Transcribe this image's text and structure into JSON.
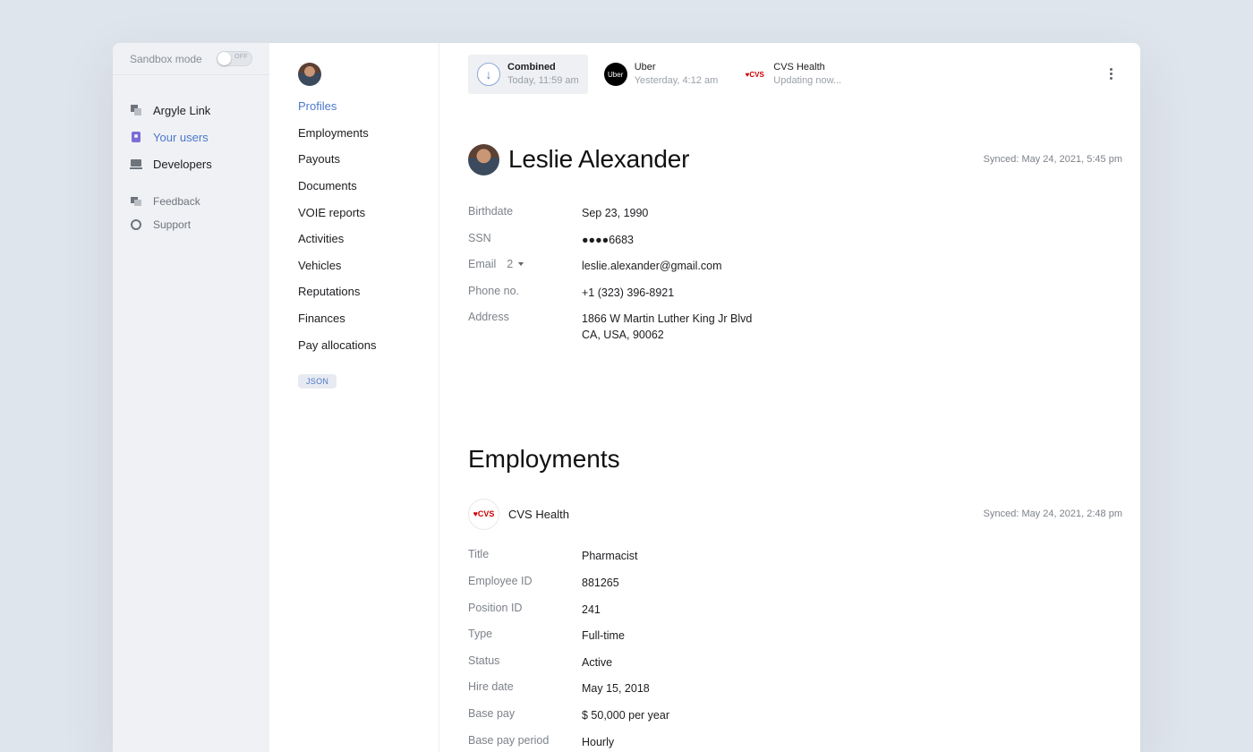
{
  "nav": {
    "sandbox_label": "Sandbox mode",
    "sandbox_toggle": "OFF",
    "items": [
      {
        "label": "Argyle Link",
        "icon": "link-icon"
      },
      {
        "label": "Your users",
        "icon": "users-icon",
        "active": true
      },
      {
        "label": "Developers",
        "icon": "laptop-icon"
      }
    ],
    "secondary": [
      {
        "label": "Feedback",
        "icon": "feedback-icon"
      },
      {
        "label": "Support",
        "icon": "support-icon"
      }
    ]
  },
  "subnav": {
    "items": [
      "Profiles",
      "Employments",
      "Payouts",
      "Documents",
      "VOIE reports",
      "Activities",
      "Vehicles",
      "Reputations",
      "Finances",
      "Pay allocations"
    ],
    "active_index": 0,
    "json_label": "JSON"
  },
  "sources": [
    {
      "name": "Combined",
      "time": "Today, 11:59 am",
      "logo_text": ""
    },
    {
      "name": "Uber",
      "time": "Yesterday, 4:12 am",
      "logo_text": "Uber"
    },
    {
      "name": "CVS Health",
      "time": "Updating now...",
      "logo_text": "♥CVS"
    }
  ],
  "profile": {
    "name": "Leslie Alexander",
    "synced": "Synced: May 24, 2021, 5:45 pm",
    "fields": [
      {
        "label": "Birthdate",
        "value": "Sep 23, 1990"
      },
      {
        "label": "SSN",
        "value": "●●●●6683"
      },
      {
        "label": "Email",
        "count": "2",
        "value": "leslie.alexander@gmail.com"
      },
      {
        "label": "Phone no.",
        "value": "+1 (323) 396-8921"
      },
      {
        "label": "Address",
        "value": "1866 W Martin Luther King Jr Blvd",
        "value2": "CA, USA, 90062"
      }
    ]
  },
  "employments": {
    "title": "Employments",
    "employer": "CVS Health",
    "logo_text": "♥CVS",
    "synced": "Synced: May 24, 2021, 2:48 pm",
    "fields": [
      {
        "label": "Title",
        "value": "Pharmacist"
      },
      {
        "label": "Employee ID",
        "value": "881265"
      },
      {
        "label": "Position ID",
        "value": "241"
      },
      {
        "label": "Type",
        "value": "Full-time"
      },
      {
        "label": "Status",
        "value": "Active"
      },
      {
        "label": "Hire date",
        "value": "May 15, 2018"
      },
      {
        "label": "Base pay",
        "value": "$ 50,000 per year"
      },
      {
        "label": "Base pay period",
        "value": "Hourly"
      }
    ]
  }
}
